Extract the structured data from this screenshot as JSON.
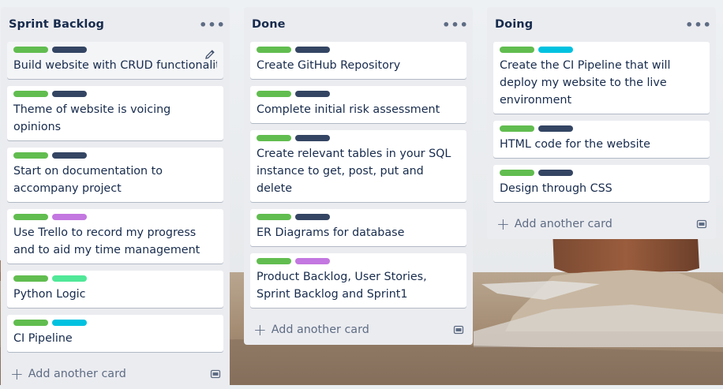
{
  "colors": {
    "green": "#61bd4f",
    "navy": "#344563",
    "purple": "#c377e0",
    "mint": "#51e898",
    "sky": "#00c2e0"
  },
  "lists": [
    {
      "title": "Sprint Backlog",
      "more_icon": "ellipsis-icon",
      "add_label": "Add another card",
      "cards": [
        {
          "title": "Build website with CRUD functionality",
          "labels": [
            "green",
            "navy"
          ]
        },
        {
          "title": "Theme of website is voicing opinions",
          "labels": [
            "green",
            "navy"
          ]
        },
        {
          "title": "Start on documentation to accompany project",
          "labels": [
            "green",
            "navy"
          ]
        },
        {
          "title": "Use Trello to record my progress and to aid my time management",
          "labels": [
            "green",
            "purple"
          ]
        },
        {
          "title": "Python Logic",
          "labels": [
            "green",
            "mint"
          ]
        },
        {
          "title": "CI Pipeline",
          "labels": [
            "green",
            "sky"
          ]
        }
      ]
    },
    {
      "title": "Done",
      "more_icon": "ellipsis-icon",
      "add_label": "Add another card",
      "cards": [
        {
          "title": "Create GitHub Repository",
          "labels": [
            "green",
            "navy"
          ]
        },
        {
          "title": "Complete initial risk assessment",
          "labels": [
            "green",
            "navy"
          ]
        },
        {
          "title": "Create relevant tables in your SQL instance to get, post, put and delete",
          "labels": [
            "green",
            "navy"
          ]
        },
        {
          "title": "ER Diagrams for database",
          "labels": [
            "green",
            "navy"
          ]
        },
        {
          "title": "Product Backlog, User Stories, Sprint Backlog and Sprint1",
          "labels": [
            "green",
            "purple"
          ]
        }
      ]
    },
    {
      "title": "Doing",
      "more_icon": "ellipsis-icon",
      "add_label": "Add another card",
      "cards": [
        {
          "title": "Create the CI Pipeline that will deploy my website to the live environment",
          "labels": [
            "green",
            "sky"
          ]
        },
        {
          "title": "HTML code for the website",
          "labels": [
            "green",
            "navy"
          ]
        },
        {
          "title": "Design through CSS",
          "labels": [
            "green",
            "navy"
          ]
        }
      ]
    }
  ]
}
